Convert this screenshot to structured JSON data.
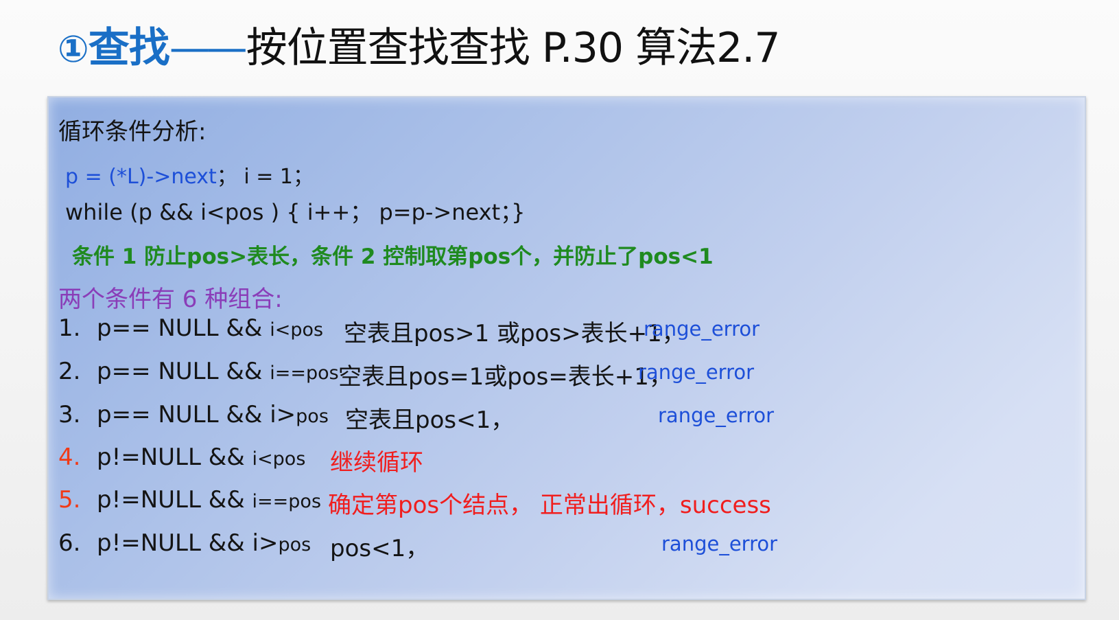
{
  "title": {
    "marker": "①",
    "keyword": "查找",
    "dash": "——",
    "rest": "按位置查找查找 P.30 算法2.7"
  },
  "panel": {
    "heading": "循环条件分析:",
    "code_line1": {
      "init": "p = (*L)->next",
      "rest": "；   i = 1；"
    },
    "code_line2": "while (p && i<pos )     { i++；  p=p->next；}",
    "green_note": "条件 1 防止pos>表长，条件 2 控制取第pos个，并防止了pos<1",
    "combo_heading": "两个条件有 6 种组合:",
    "items": [
      {
        "index": "1.",
        "cond_main": "p== NULL && ",
        "cond_small": "i<pos",
        "desc": "空表且pos>1 或pos>表长+1，",
        "error": "range_error"
      },
      {
        "index": "2.",
        "cond_main": "p== NULL && ",
        "cond_small": "i==pos",
        "desc": "空表且pos=1或pos=表长+1，",
        "error": "range_error"
      },
      {
        "index": "3.",
        "cond_main": "p== NULL && i>",
        "cond_small": "pos",
        "desc": "空表且pos<1，",
        "error": "range_error"
      },
      {
        "index": "4.",
        "cond_main": "p!=NULL && ",
        "cond_small": "i<pos",
        "desc": "继续循环",
        "error": ""
      },
      {
        "index": "5.",
        "cond_main": "p!=NULL && ",
        "cond_small": "i==pos",
        "desc": "确定第pos个结点， 正常出循环，success",
        "error": ""
      },
      {
        "index": "6.",
        "cond_main": "p!=NULL && i>",
        "cond_small": "pos",
        "desc": "pos<1，",
        "error": "range_error"
      }
    ]
  },
  "colors": {
    "title_blue": "#1a6fc6",
    "code_blue": "#1d4fd8",
    "note_green": "#1f8a1f",
    "combo_purple": "#8a3db8",
    "highlight_red": "#f01e1e",
    "index_red": "#f03a17"
  }
}
